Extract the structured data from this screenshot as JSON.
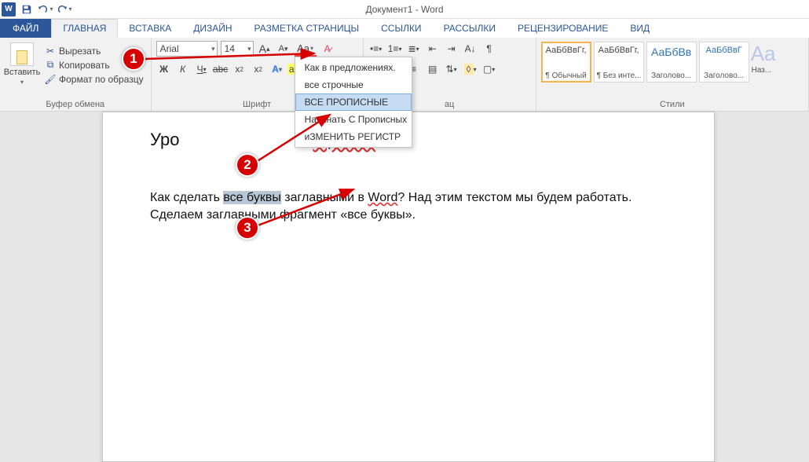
{
  "app": {
    "title": "Документ1 - Word"
  },
  "qat": {
    "save": "save",
    "undo": "undo",
    "redo": "redo"
  },
  "tabs": {
    "file": "ФАЙЛ",
    "list": [
      "ГЛАВНАЯ",
      "ВСТАВКА",
      "ДИЗАЙН",
      "РАЗМЕТКА СТРАНИЦЫ",
      "ССЫЛКИ",
      "РАССЫЛКИ",
      "РЕЦЕНЗИРОВАНИЕ",
      "ВИД"
    ],
    "active_index": 0
  },
  "clipboard": {
    "paste": "Вставить",
    "cut": "Вырезать",
    "copy": "Копировать",
    "format_painter": "Формат по образцу",
    "group_label": "Буфер обмена"
  },
  "font": {
    "name": "Arial",
    "size": "14",
    "group_label": "Шрифт",
    "bold": "Ж",
    "italic": "К",
    "underline": "Ч",
    "strike": "abc",
    "sub": "x",
    "sup": "x"
  },
  "change_case": {
    "button_text": "Aa",
    "items": [
      "Как в предложениях.",
      "все строчные",
      "ВСЕ ПРОПИСНЫЕ",
      "Начинать С Прописных",
      "иЗМЕНИТЬ РЕГИСТР"
    ],
    "hover_index": 2
  },
  "paragraph": {
    "group_label": "ац"
  },
  "styles": {
    "group_label": "Стили",
    "items": [
      {
        "sample": "АаБбВвГг,",
        "name": "¶ Обычный",
        "color": "#000"
      },
      {
        "sample": "АаБбВвГг,",
        "name": "¶ Без инте...",
        "color": "#000"
      },
      {
        "sample": "АаБбВв",
        "name": "Заголово...",
        "color": "#2e74b5"
      },
      {
        "sample": "АаБбВвГ",
        "name": "Заголово...",
        "color": "#2e74b5"
      }
    ],
    "more": "Наз..."
  },
  "document": {
    "heading_pre": "Уро",
    "heading_post": "tapok.ru",
    "para_pre": "Как сделать ",
    "para_sel": "все буквы",
    "para_mid1": " заглавными в ",
    "para_link": "Word",
    "para_mid2": "? Над этим текстом мы будем работать. Сделаем заглавными фрагмент «все буквы»."
  },
  "bubbles": {
    "b1": "1",
    "b2": "2",
    "b3": "3"
  }
}
